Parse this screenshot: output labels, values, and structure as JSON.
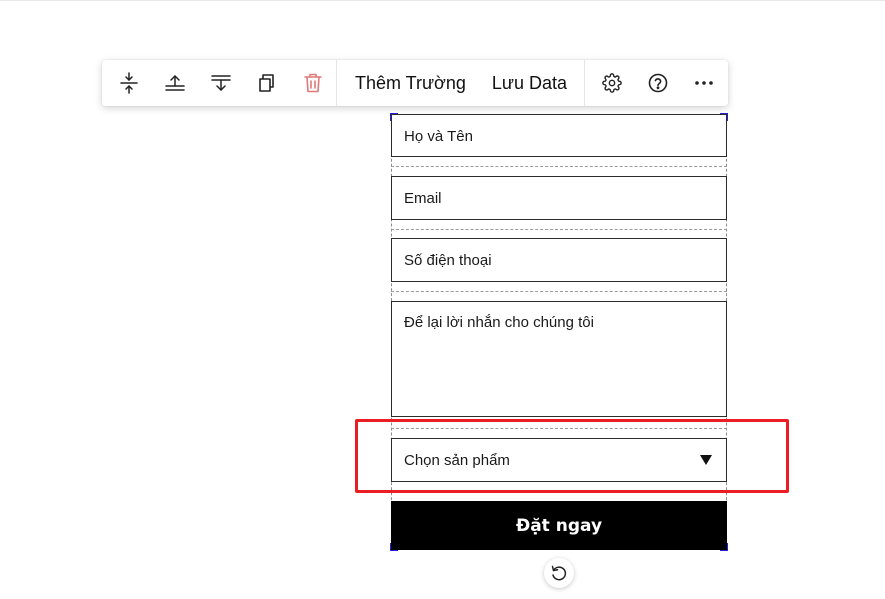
{
  "toolbar": {
    "icons": {
      "distribute": "vertical-distribute-icon",
      "align_top": "align-top-icon",
      "align_bottom": "align-bottom-icon",
      "duplicate": "copy-icon",
      "delete": "trash-icon",
      "settings": "gear-icon",
      "help": "question-circle-icon",
      "more": "more-horizontal-icon"
    },
    "add_field_label": "Thêm Trường",
    "save_data_label": "Lưu Data",
    "delete_color": "#e07a7a"
  },
  "form": {
    "fields": {
      "name_placeholder": "Họ và Tên",
      "email_placeholder": "Email",
      "phone_placeholder": "Số điện thoại",
      "message_placeholder": "Để lại lời nhắn cho chúng tôi",
      "product_select_value": "Chọn sản phẩm"
    },
    "submit_label": "Đặt ngay",
    "selection_color": "#2a1fd6"
  },
  "highlight": {
    "color": "#ea1c24"
  },
  "rotate_handle": {
    "icon": "rotate-icon"
  }
}
